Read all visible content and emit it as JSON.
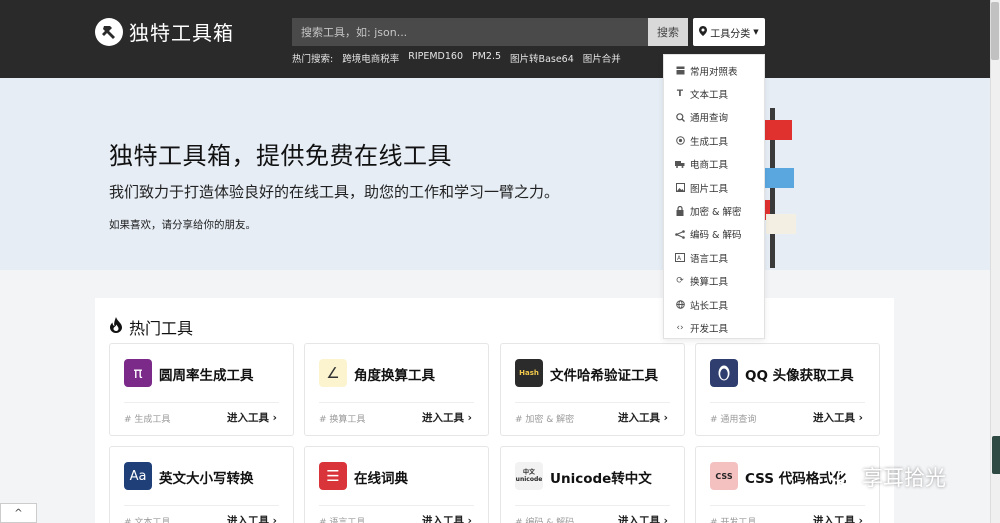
{
  "header": {
    "logo_text": "独特工具箱",
    "search_placeholder": "搜索工具，如: json...",
    "search_button": "搜索",
    "category_button": "工具分类",
    "hot_label": "热门搜索:",
    "hot_items": [
      "跨境电商税率",
      "RIPEMD160",
      "PM2.5",
      "图片转Base64",
      "图片合并"
    ]
  },
  "hero": {
    "title": "独特工具箱，提供免费在线工具",
    "subtitle": "我们致力于打造体验良好的在线工具，助您的工作和学习一臂之力。",
    "share": "如果喜欢，请分享给你的朋友。"
  },
  "categories": [
    {
      "label": "常用对照表",
      "icon": "table-icon"
    },
    {
      "label": "文本工具",
      "icon": "text-icon"
    },
    {
      "label": "通用查询",
      "icon": "search-icon"
    },
    {
      "label": "生成工具",
      "icon": "generate-icon"
    },
    {
      "label": "电商工具",
      "icon": "truck-icon"
    },
    {
      "label": "图片工具",
      "icon": "image-icon"
    },
    {
      "label": "加密 & 解密",
      "icon": "lock-icon"
    },
    {
      "label": "编码 & 解码",
      "icon": "code-branch-icon"
    },
    {
      "label": "语言工具",
      "icon": "language-icon"
    },
    {
      "label": "换算工具",
      "icon": "refresh-icon"
    },
    {
      "label": "站长工具",
      "icon": "globe-icon"
    },
    {
      "label": "开发工具",
      "icon": "code-icon"
    }
  ],
  "hot_tools": {
    "title": "热门工具",
    "enter_label": "进入工具",
    "tools": [
      {
        "name": "圆周率生成工具",
        "tag": "# 生成工具",
        "icon_text": "π",
        "icon_bg": "#7b2a8a",
        "icon_color": "#ffffff"
      },
      {
        "name": "角度换算工具",
        "tag": "# 换算工具",
        "icon_text": "∠",
        "icon_bg": "#fbf4cf",
        "icon_color": "#333333"
      },
      {
        "name": "文件哈希验证工具",
        "tag": "# 加密 & 解密",
        "icon_text": "Hash",
        "icon_bg": "#2b2b2b",
        "icon_color": "#f2c94c"
      },
      {
        "name": "QQ 头像获取工具",
        "tag": "# 通用查询",
        "icon_text": "QQ",
        "icon_bg": "#2f3e6e",
        "icon_color": "#ffffff"
      },
      {
        "name": "英文大小写转换",
        "tag": "# 文本工具",
        "icon_text": "Aa",
        "icon_bg": "#1e3f78",
        "icon_color": "#ffffff"
      },
      {
        "name": "在线词典",
        "tag": "# 语言工具",
        "icon_text": "☰",
        "icon_bg": "#d8343a",
        "icon_color": "#ffffff"
      },
      {
        "name": "Unicode转中文",
        "tag": "# 编码 & 解码",
        "icon_text": "中文 unicode",
        "icon_bg": "#f2f2f2",
        "icon_color": "#222222"
      },
      {
        "name": "CSS 代码格式化",
        "tag": "# 开发工具",
        "icon_text": "CSS",
        "icon_bg": "#f4c0c0",
        "icon_color": "#222222"
      }
    ]
  },
  "watermark": "享耳拾光",
  "back_to_top": "^"
}
